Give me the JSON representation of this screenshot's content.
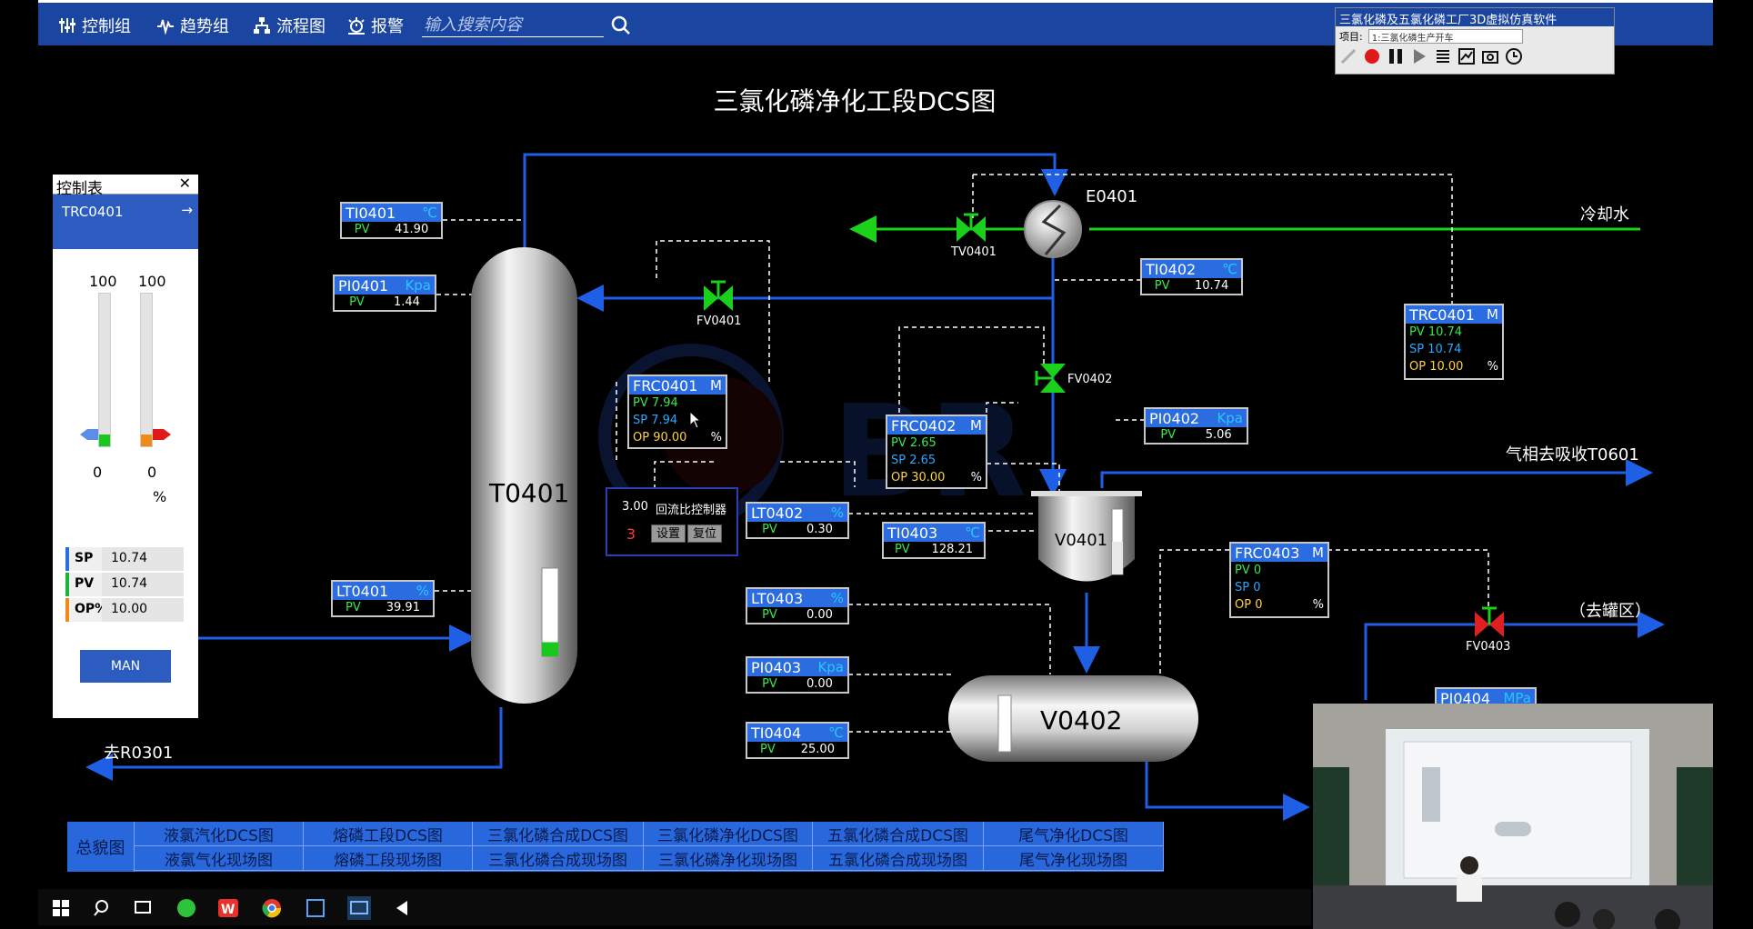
{
  "menu": {
    "items": [
      {
        "label": "控制组",
        "icon": "sliders-icon"
      },
      {
        "label": "趋势组",
        "icon": "trend-icon"
      },
      {
        "label": "流程图",
        "icon": "flowchart-icon"
      },
      {
        "label": "报警",
        "icon": "alarm-icon"
      }
    ],
    "search_placeholder": "输入搜索内容"
  },
  "sim_window": {
    "title": "三氯化磷及五氯化磷工厂3D虚拟仿真软件",
    "project_label": "项目:",
    "project_value": "1:三氯化磷生产开车"
  },
  "page_title": "三氯化磷净化工段DCS图",
  "control_table": {
    "title": "控制表",
    "selected_loop": "TRC0401",
    "scale_top_left": "100",
    "scale_top_right": "100",
    "scale_bottom_left": "0",
    "scale_bottom_right": "0",
    "unit": "%",
    "sp_fill": 0.08,
    "op_fill": 0.08,
    "rows": [
      {
        "key": "SP",
        "value": "10.74",
        "color": "#2b6de0"
      },
      {
        "key": "PV",
        "value": "10.74",
        "color": "#1cb33a"
      },
      {
        "key": "OP%",
        "value": "10.00",
        "color": "#f08a18"
      }
    ],
    "mode_button": "MAN"
  },
  "tags": {
    "TI0401": {
      "name": "TI0401",
      "unit": "℃",
      "pv_label": "PV",
      "pv": "41.90"
    },
    "PI0401": {
      "name": "PI0401",
      "unit": "Kpa",
      "pv_label": "PV",
      "pv": "1.44"
    },
    "LT0401": {
      "name": "LT0401",
      "unit": "%",
      "pv_label": "PV",
      "pv": "39.91"
    },
    "TI0402": {
      "name": "TI0402",
      "unit": "℃",
      "pv_label": "PV",
      "pv": "10.74"
    },
    "PI0402": {
      "name": "PI0402",
      "unit": "Kpa",
      "pv_label": "PV",
      "pv": "5.06"
    },
    "LT0402": {
      "name": "LT0402",
      "unit": "%",
      "pv_label": "PV",
      "pv": "0.30"
    },
    "TI0403": {
      "name": "TI0403",
      "unit": "℃",
      "pv_label": "PV",
      "pv": "128.21"
    },
    "LT0403": {
      "name": "LT0403",
      "unit": "%",
      "pv_label": "PV",
      "pv": "0.00"
    },
    "PI0403": {
      "name": "PI0403",
      "unit": "Kpa",
      "pv_label": "PV",
      "pv": "0.00"
    },
    "TI0404": {
      "name": "TI0404",
      "unit": "℃",
      "pv_label": "PV",
      "pv": "25.00"
    },
    "PI0404": {
      "name": "PI0404",
      "unit": "MPa"
    }
  },
  "controllers": {
    "FRC0401": {
      "name": "FRC0401",
      "mode": "M",
      "pv": "PV 7.94",
      "sp": "SP 7.94",
      "op": "OP 90.00",
      "op_unit": "%"
    },
    "FRC0402": {
      "name": "FRC0402",
      "mode": "M",
      "pv": "PV 2.65",
      "sp": "SP 2.65",
      "op": "OP 30.00",
      "op_unit": "%"
    },
    "TRC0401": {
      "name": "TRC0401",
      "mode": "M",
      "pv": "PV 10.74",
      "sp": "SP 10.74",
      "op": "OP 10.00",
      "op_unit": "%"
    },
    "FRC0403": {
      "name": "FRC0403",
      "mode": "M",
      "pv": "PV 0",
      "sp": "SP 0",
      "op": "OP 0",
      "op_unit": "%"
    }
  },
  "ratio_controller": {
    "value": "3.00",
    "label": "回流比控制器",
    "count": "3",
    "set_button": "设置",
    "reset_button": "复位"
  },
  "equipment": {
    "column": "T0401",
    "exchanger": "E0401",
    "tank_v0401": "V0401",
    "tank_v0402": "V0402",
    "column_level": 0.16,
    "v0401_level": 0.5
  },
  "valves": {
    "tv0401": "TV0401",
    "fv0401": "FV0401",
    "fv0402": "FV0402",
    "fv0403": "FV0403"
  },
  "stream_labels": {
    "cooling_water": "冷却水",
    "gas_to_absorb": "气相去吸收T0601",
    "to_tank": "（去罐区）",
    "to_r0301": "去R0301"
  },
  "nav": {
    "overview": "总貌图",
    "row1": [
      "液氯汽化DCS图",
      "熔磷工段DCS图",
      "三氯化磷合成DCS图",
      "三氯化磷净化DCS图",
      "五氯化磷合成DCS图",
      "尾气净化DCS图"
    ],
    "row2": [
      "液氯气化现场图",
      "熔磷工段现场图",
      "三氯化磷合成现场图",
      "三氯化磷净化现场图",
      "五氯化磷合成现场图",
      "尾气净化现场图"
    ]
  },
  "colors": {
    "pipe_blue": "#1f5fe6",
    "pipe_green": "#19d219",
    "valve_green": "#1ad01a",
    "valve_red": "#e02020"
  }
}
